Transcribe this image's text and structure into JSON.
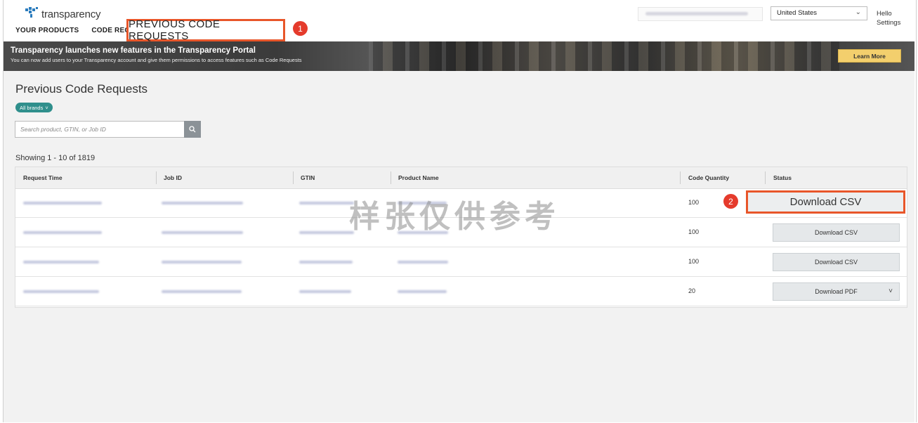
{
  "app": {
    "logo_text": "transparency"
  },
  "nav": {
    "items": [
      "YOUR PRODUCTS",
      "CODE REQUESTS"
    ],
    "active": "PREVIOUS CODE REQUESTS"
  },
  "callouts": [
    "1",
    "2"
  ],
  "header": {
    "country": "United States",
    "greeting": "Hello",
    "settings": "Settings"
  },
  "banner": {
    "title": "Transparency launches new features in the Transparency Portal",
    "subtitle": "You can now add users to your Transparency account and give them permissions to access features such as Code Requests",
    "cta": "Learn More"
  },
  "main": {
    "title": "Previous Code Requests",
    "brand_filter": "All brands",
    "search_placeholder": "Search product, GTIN, or Job ID",
    "showing": "Showing 1 - 10 of 1819"
  },
  "table": {
    "columns": [
      "Request Time",
      "Job ID",
      "GTIN",
      "Product Name",
      "Code Quantity",
      "Status"
    ],
    "rows": [
      {
        "quantity": "100",
        "status": "Download CSV",
        "has_menu": false
      },
      {
        "quantity": "100",
        "status": "Download CSV",
        "has_menu": false
      },
      {
        "quantity": "100",
        "status": "Download CSV",
        "has_menu": false
      },
      {
        "quantity": "20",
        "status": "Download PDF",
        "has_menu": true
      }
    ]
  },
  "watermark": "样张仅供参考",
  "icons": {
    "logo": "transparency-logo-icon",
    "search": "search-icon",
    "chevron": "chevron-down-icon"
  },
  "colors": {
    "highlight": "#e8562a",
    "badge": "#e53b2c",
    "pill": "#2f8f8c",
    "cta": "#f3cf6d"
  }
}
